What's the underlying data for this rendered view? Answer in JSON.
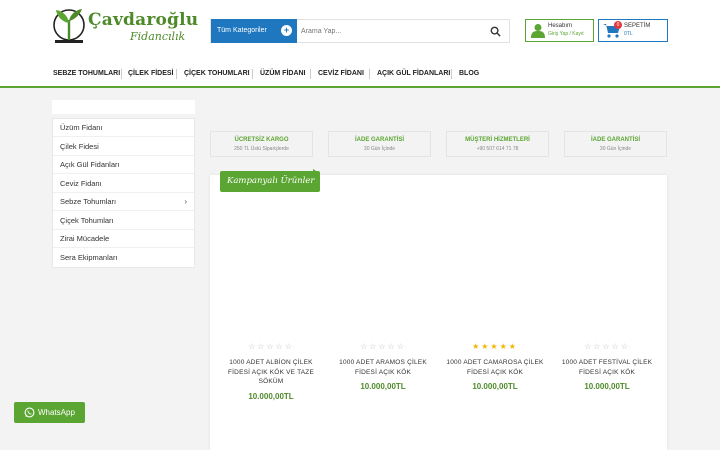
{
  "brand": {
    "name": "Çavdaroğlu",
    "tagline": "Fidancılık",
    "colors": {
      "green": "#5ba532",
      "blue": "#1f77bf",
      "badge": "#e0383e",
      "star": "#f2b600"
    }
  },
  "search": {
    "category_label": "Tüm Kategoriler",
    "placeholder": "Arama Yap...",
    "icons": {
      "category": "plus-circle-icon",
      "submit": "search-icon"
    }
  },
  "account": {
    "title": "Hesabım",
    "subtitle": "Giriş Yap / Kayıt",
    "icon": "user-icon"
  },
  "cart": {
    "title": "SEPETİM",
    "total": "0TL",
    "count": "0",
    "icon": "cart-icon"
  },
  "nav": [
    {
      "label": "SEBZE TOHUMLARI"
    },
    {
      "label": "ÇİLEK FİDESİ"
    },
    {
      "label": "ÇİÇEK TOHUMLARI"
    },
    {
      "label": "ÜZÜM FİDANI"
    },
    {
      "label": "CEVİZ FİDANI"
    },
    {
      "label": "AÇIK GÜL FİDANLARI"
    },
    {
      "label": "BLOG"
    }
  ],
  "sidebar": [
    {
      "label": "Üzüm Fidanı"
    },
    {
      "label": "Çilek Fidesi"
    },
    {
      "label": "Açık Gül Fidanları"
    },
    {
      "label": "Ceviz Fidanı"
    },
    {
      "label": "Sebze Tohumları",
      "chevron": "›"
    },
    {
      "label": "Çiçek Tohumları"
    },
    {
      "label": "Zirai Mücadele"
    },
    {
      "label": "Sera Ekipmanları"
    }
  ],
  "info_boxes": [
    {
      "title": "ÜCRETSİZ KARGO",
      "subtitle": "250 TL Üstü Siparişlerde"
    },
    {
      "title": "İADE GARANTİSİ",
      "subtitle": "30 Gün İçinde"
    },
    {
      "title": "MÜŞTERİ HİZMETLERİ",
      "subtitle": "+90 507 614 71 78"
    },
    {
      "title": "İADE GARANTİSİ",
      "subtitle": "30 Gün İçinde"
    }
  ],
  "campaign": {
    "title": "Kampanyalı Ürünler",
    "products": [
      {
        "name": "1000 ADET ALBİON ÇİLEK FİDESİ AÇIK KÖK VE TAZE SÖKÜM",
        "price": "10.000,00TL",
        "rating": 0,
        "stars": "☆☆☆☆☆"
      },
      {
        "name": "1000 ADET ARAMOS ÇİLEK FİDESİ AÇIK KÖK",
        "price": "10.000,00TL",
        "rating": 0,
        "stars": "☆☆☆☆☆"
      },
      {
        "name": "1000 ADET CAMAROSA ÇİLEK FİDESİ AÇIK KÖK",
        "price": "10.000,00TL",
        "rating": 5,
        "stars": "★★★★★"
      },
      {
        "name": "1000 ADET FESTİVAL ÇİLEK FİDESİ AÇIK KÖK",
        "price": "10.000,00TL",
        "rating": 0,
        "stars": "☆☆☆☆☆"
      }
    ]
  },
  "whatsapp": {
    "label": "WhatsApp",
    "icon": "whatsapp-icon"
  }
}
